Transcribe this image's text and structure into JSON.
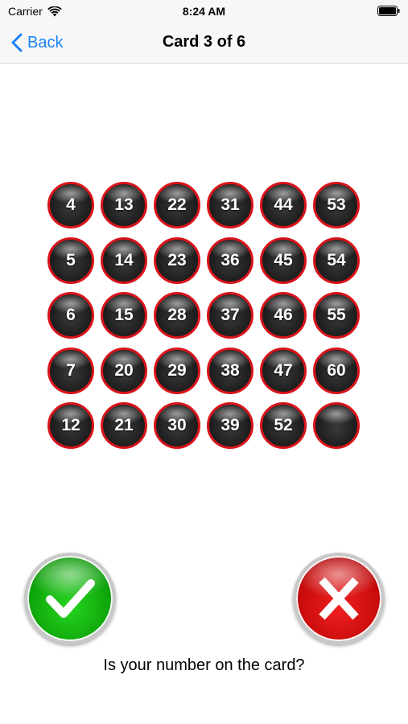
{
  "status_bar": {
    "carrier": "Carrier",
    "time": "8:24 AM"
  },
  "nav": {
    "back_label": "Back",
    "title": "Card 3 of 6"
  },
  "card": {
    "rows": [
      [
        "4",
        "13",
        "22",
        "31",
        "44",
        "53"
      ],
      [
        "5",
        "14",
        "23",
        "36",
        "45",
        "54"
      ],
      [
        "6",
        "15",
        "28",
        "37",
        "46",
        "55"
      ],
      [
        "7",
        "20",
        "29",
        "38",
        "47",
        "60"
      ],
      [
        "12",
        "21",
        "30",
        "39",
        "52",
        ""
      ]
    ]
  },
  "answers": {
    "yes_icon": "checkmark-icon",
    "no_icon": "x-icon",
    "yes_color": "#0ea40a",
    "no_color": "#c80b0b"
  },
  "prompt": "Is your number on the card?",
  "colors": {
    "accent": "#1a82fb",
    "ball_border": "#d9141b"
  }
}
